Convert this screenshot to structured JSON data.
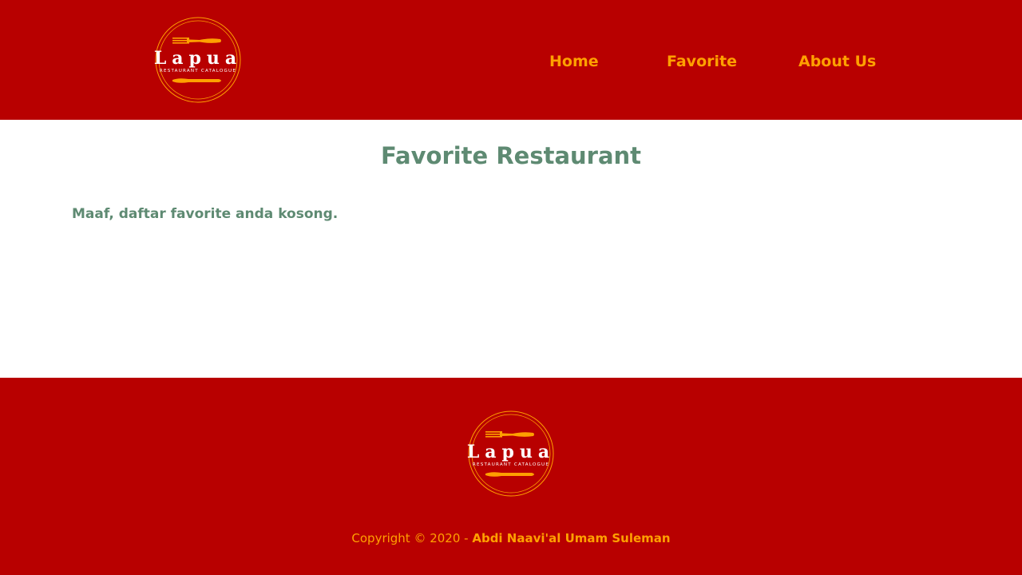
{
  "colors": {
    "brand": "#b80000",
    "accent": "#ffa000",
    "heading": "#5e8a72"
  },
  "header": {
    "logo": {
      "title": "Lapua",
      "subtitle": "RESTAURANT CATALOGUE",
      "icons": [
        "fork-icon",
        "knife-icon"
      ]
    },
    "nav": {
      "home": "Home",
      "favorite": "Favorite",
      "about": "About Us"
    }
  },
  "main": {
    "title": "Favorite Restaurant",
    "empty_message": "Maaf, daftar favorite anda kosong."
  },
  "footer": {
    "logo": {
      "title": "Lapua",
      "subtitle": "RESTAURANT CATALOGUE"
    },
    "copyright_prefix": "Copyright © 2020 - ",
    "author": "Abdi Naavi'al Umam Suleman"
  }
}
